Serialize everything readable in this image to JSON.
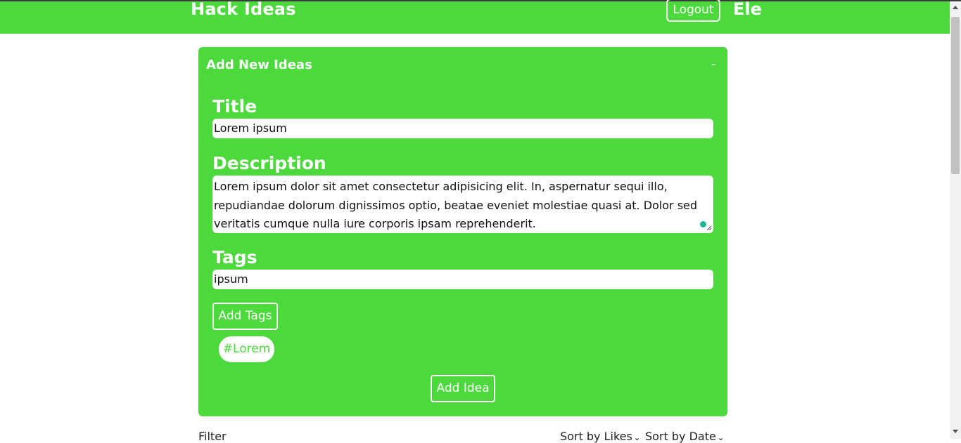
{
  "navbar": {
    "brand": "Hack Ideas",
    "logout_label": "Logout",
    "user_name": "Ele",
    "color": "#4cd93c"
  },
  "form": {
    "card_title": "Add New Ideas",
    "collapse_label": "-",
    "title_label": "Title",
    "title_value": "Lorem ipsum",
    "description_label": "Description",
    "description_value": "Lorem ipsum dolor sit amet consectetur adipisicing elit. In, aspernatur sequi illo, repudiandae dolorum dignissimos optio, beatae eveniet molestiae quasi at. Dolor sed veritatis cumque nulla iure corporis ipsam reprehenderit.",
    "tags_label": "Tags",
    "tags_value": "ipsum",
    "add_tags_label": "Add Tags",
    "tags": [
      "#Lorem"
    ],
    "add_idea_label": "Add Idea"
  },
  "controls": {
    "filter_label": "Filter",
    "sort_likes_label": "Sort by Likes",
    "sort_date_label": "Sort by Date"
  }
}
